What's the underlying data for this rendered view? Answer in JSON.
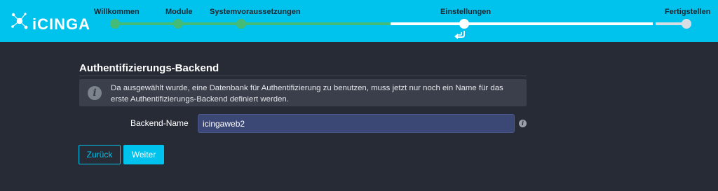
{
  "brand": {
    "name": "iCINGA",
    "accent": "#00c3ed",
    "done_color": "#44bb77"
  },
  "wizard": {
    "steps": [
      {
        "label": "Willkommen",
        "state": "done"
      },
      {
        "label": "Module",
        "state": "done"
      },
      {
        "label": "Systemvoraussetzungen",
        "state": "done"
      },
      {
        "label": "Einstellungen",
        "state": "current"
      },
      {
        "label": "Fertigstellen",
        "state": "pending"
      }
    ],
    "current_marker_icon": "double-arrow-return-icon"
  },
  "section": {
    "title": "Authentifizierungs-Backend",
    "info_icon": "info-icon",
    "info_text": "Da ausgewählt wurde, eine Datenbank für Authentifizierung zu benutzen, muss jetzt nur noch ein Name für das erste Authentifizierungs-Backend definiert werden."
  },
  "form": {
    "backend_name_label": "Backend-Name",
    "backend_name_value": "icingaweb2",
    "field_help_icon": "info-icon"
  },
  "buttons": {
    "back_label": "Zurück",
    "next_label": "Weiter"
  }
}
